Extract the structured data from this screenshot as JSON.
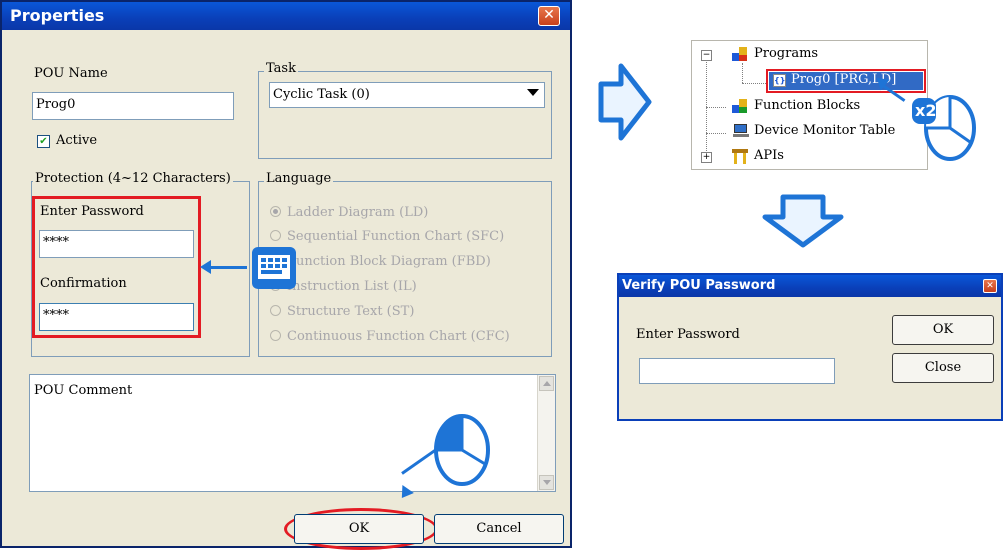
{
  "properties": {
    "title": "Properties",
    "pou_name_label": "POU Name",
    "pou_name_value": "Prog0",
    "active_label": "Active",
    "task_legend": "Task",
    "task_value": "Cyclic Task (0)",
    "protection_legend": "Protection (4~12 Characters)",
    "enter_password_label": "Enter Password",
    "enter_password_value": "****",
    "confirmation_label": "Confirmation",
    "confirmation_value": "****",
    "language_legend": "Language",
    "languages": [
      "Ladder Diagram (LD)",
      "Sequential Function Chart (SFC)",
      "Function Block Diagram (FBD)",
      "Instruction List (IL)",
      "Structure Text (ST)",
      "Continuous Function Chart (CFC)"
    ],
    "comment_value": "POU Comment",
    "ok_label": "OK",
    "cancel_label": "Cancel"
  },
  "tree": {
    "items": [
      {
        "label": "Programs",
        "expander": "−"
      },
      {
        "label": "Prog0 [PRG,LD]"
      },
      {
        "label": "Function Blocks"
      },
      {
        "label": "Device Monitor Table"
      },
      {
        "label": "APIs",
        "expander": "+"
      }
    ],
    "double_click_badge": "x2"
  },
  "verify": {
    "title": "Verify POU Password",
    "enter_password_label": "Enter Password",
    "password_value": "",
    "ok_label": "OK",
    "close_label": "Close"
  },
  "colors": {
    "highlight_red": "#e31b23",
    "arrow_blue": "#1e74d6",
    "titlebar_blue": "#0a3fb8"
  },
  "icons": [
    "close-icon",
    "checkbox-checked-icon",
    "dropdown-arrow-icon",
    "keyboard-icon",
    "mouse-icon",
    "flow-arrow-right-icon",
    "flow-arrow-down-icon",
    "scroll-up-icon",
    "scroll-down-icon",
    "program-folder-icon",
    "program-icon",
    "function-blocks-icon",
    "device-monitor-icon",
    "apis-icon"
  ]
}
